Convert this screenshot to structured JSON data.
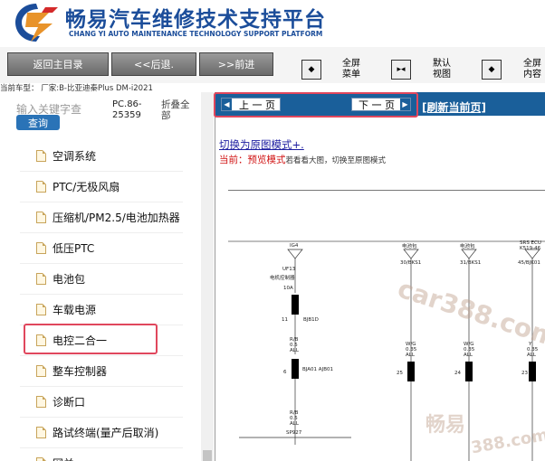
{
  "header": {
    "title_cn": "畅易汽车维修技术支持平台",
    "title_en": "CHANG YI AUTO MAINTENANCE TECHNOLOGY SUPPORT PLATFORM"
  },
  "toolbar": {
    "home_label": "返回主目录",
    "back_label": "<<后退.",
    "forward_label": ">>前进",
    "fullscreen_menu": "全屏\n菜单",
    "default_view": "默认\n视图",
    "fullscreen_content": "全屏\n内容"
  },
  "vehicle_line": "当前车型：  厂家:B-比亚迪秦Plus DM-i2021",
  "sidebar": {
    "search_placeholder": "输入关键字查",
    "search_button": "查询",
    "pc_code": "PC.86-25359",
    "collapse_all": "折叠全部",
    "items": [
      {
        "label": "空调系统"
      },
      {
        "label": "PTC/无极风扇"
      },
      {
        "label": "压缩机/PM2.5/电池加热器"
      },
      {
        "label": "低压PTC"
      },
      {
        "label": "电池包"
      },
      {
        "label": "车载电源"
      },
      {
        "label": "电控二合一"
      },
      {
        "label": "整车控制器"
      },
      {
        "label": "诊断口"
      },
      {
        "label": "路试终端(量产后取消)"
      },
      {
        "label": "网关"
      }
    ],
    "selected_index": 6
  },
  "content": {
    "prev_page": "上 一 页",
    "next_page": "下 一 页",
    "refresh": "[刷新当前页]",
    "switch_mode": "切换为原图模式+.",
    "current_prefix": "当前：",
    "current_mode": "预览模式",
    "current_hint": "若看看大图，切换至原图模式"
  },
  "diagram": {
    "labels": {
      "top1": "IG4",
      "top2": "电池包",
      "top3": "电池包",
      "top4": "SRS ECU",
      "code1": "30/BKS1",
      "code2": "31/BKS1",
      "code3": "45/BJK01",
      "sub4": "K519-46",
      "fuse1": "UF13",
      "fuse_desc": "电机控制器",
      "amp": "10A",
      "conn1": "BJB1D",
      "n11": "11",
      "rb": "R/B",
      "wire05": "0.5",
      "all": "ALL",
      "bjaj": "BJA01\nAJB01",
      "n6": "6",
      "n25": "25",
      "n24": "24",
      "n23": "23",
      "wg": "W/G",
      "wire035": "0.35",
      "y": "Y",
      "sp": "SP927",
      "n5": "5",
      "n10": "10"
    }
  },
  "watermarks": {
    "domain": "car388.com",
    "brand": "畅易",
    "num": "388.com"
  }
}
